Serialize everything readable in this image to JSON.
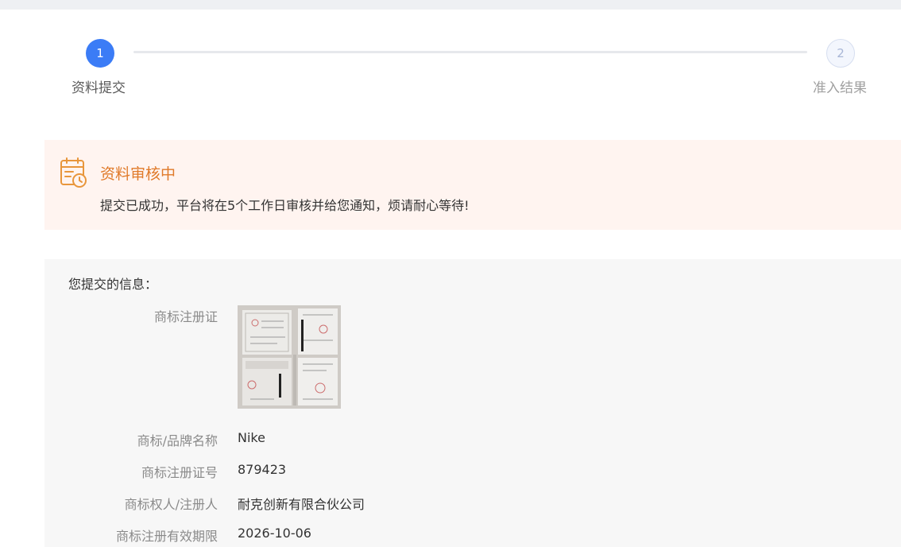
{
  "steps": [
    {
      "number": "1",
      "label": "资料提交",
      "state": "active"
    },
    {
      "number": "2",
      "label": "准入结果",
      "state": "pending"
    }
  ],
  "notice": {
    "icon": "calendar-clock-icon",
    "title": "资料审核中",
    "text": "提交已成功，平台将在5个工作日审核并给您通知，烦请耐心等待!"
  },
  "info": {
    "heading": "您提交的信息：",
    "fields": [
      {
        "label": "商标注册证",
        "value": ""
      },
      {
        "label": "商标/品牌名称",
        "value": "Nike"
      },
      {
        "label": "商标注册证号",
        "value": "879423"
      },
      {
        "label": "商标权人/注册人",
        "value": "耐克创新有限合伙公司"
      },
      {
        "label": "商标注册有效期限",
        "value": "2026-10-06"
      }
    ]
  },
  "colors": {
    "primary": "#3b7cf6",
    "notice_bg": "#fff4f0",
    "notice_title": "#e07a2a",
    "panel_bg": "#f7f7f7"
  }
}
